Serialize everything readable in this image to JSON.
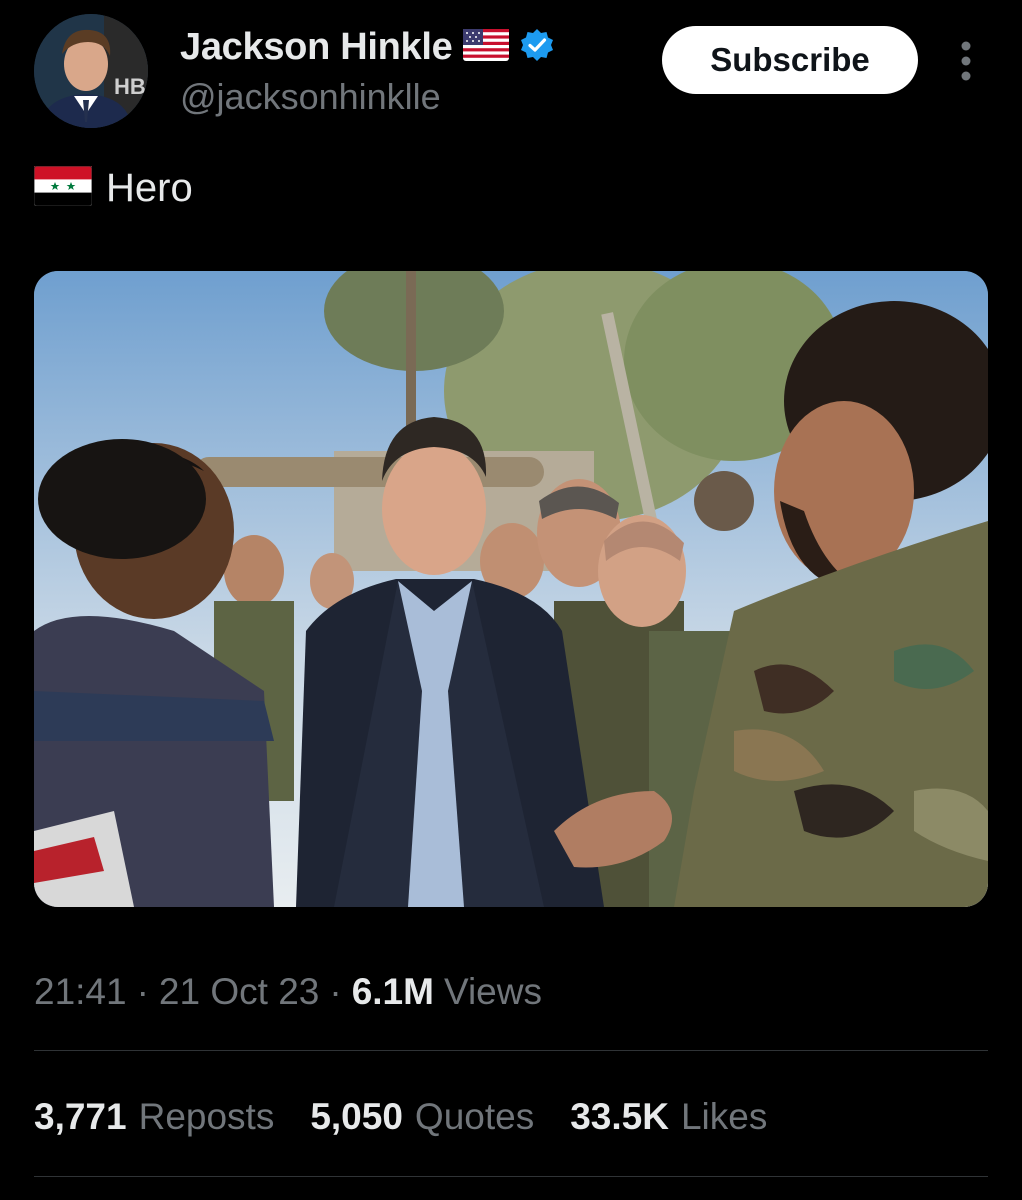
{
  "author": {
    "display_name": "Jackson Hinkle",
    "handle": "@jacksonhinklle",
    "flag_icon": "us-flag-icon",
    "verified_icon": "verified-badge-icon",
    "verified_color": "#1d9bf0",
    "avatar_logo_text": "HB"
  },
  "actions": {
    "subscribe_label": "Subscribe",
    "more_icon": "more-vertical-icon"
  },
  "tweet": {
    "flag_icon": "syria-flag-icon",
    "text": "Hero",
    "media_description": "photo"
  },
  "meta": {
    "time": "21:41",
    "separator": "·",
    "date": "21 Oct 23",
    "views_count": "6.1M",
    "views_label": "Views"
  },
  "stats": {
    "reposts_count": "3,771",
    "reposts_label": "Reposts",
    "quotes_count": "5,050",
    "quotes_label": "Quotes",
    "likes_count": "33.5K",
    "likes_label": "Likes"
  },
  "colors": {
    "background": "#000000",
    "primary_text": "#e7e9ea",
    "secondary_text": "#71767b",
    "divider": "#2f3336"
  }
}
